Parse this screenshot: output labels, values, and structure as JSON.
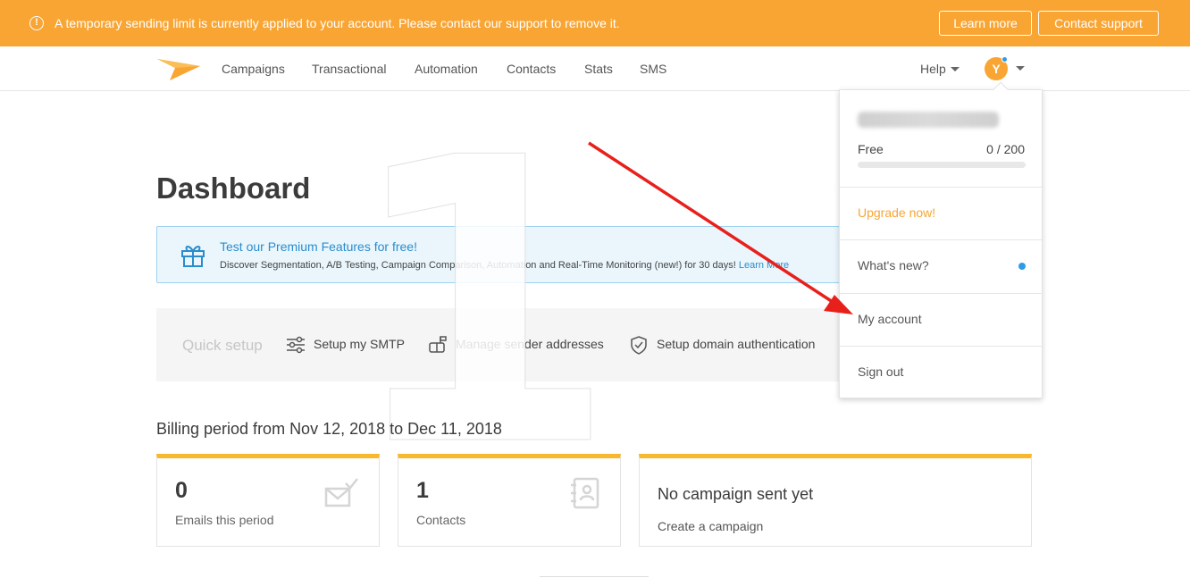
{
  "alert": {
    "icon": "exclamation-circle-icon",
    "message": "A temporary sending limit is currently applied to your account. Please contact our support to remove it.",
    "learn_more": "Learn more",
    "contact_support": "Contact support"
  },
  "nav": {
    "logo": "paper-plane-logo-icon",
    "items": [
      "Campaigns",
      "Transactional",
      "Automation",
      "Contacts",
      "Stats",
      "SMS"
    ],
    "help": "Help",
    "avatar_initial": "Y"
  },
  "page": {
    "title": "Dashboard"
  },
  "premium": {
    "icon": "gift-icon",
    "title": "Test our Premium Features for free!",
    "description": "Discover Segmentation, A/B Testing, Campaign Comparison, Automation and Real-Time Monitoring (new!) for 30 days!",
    "link": "Learn More"
  },
  "quick_setup": {
    "label": "Quick setup",
    "items": [
      {
        "icon": "sliders-icon",
        "label": "Setup my SMTP"
      },
      {
        "icon": "mailbox-icon",
        "label": "Manage sender addresses"
      },
      {
        "icon": "shield-check-icon",
        "label": "Setup domain authentication"
      }
    ]
  },
  "annotation": {
    "step_number": "1",
    "arrow_color": "#e8201c"
  },
  "billing": {
    "period": "Billing period from Nov 12, 2018 to Dec 11, 2018",
    "cards": [
      {
        "value": "0",
        "label": "Emails this period",
        "icon": "envelope-check-icon"
      },
      {
        "value": "1",
        "label": "Contacts",
        "icon": "address-book-icon"
      }
    ],
    "campaign_card": {
      "title": "No campaign sent yet",
      "link": "Create a campaign"
    }
  },
  "dropdown": {
    "plan": "Free",
    "quota": "0 / 200",
    "quota_fraction": 0,
    "upgrade": "Upgrade now!",
    "whats_new": "What's new?",
    "my_account": "My account",
    "sign_out": "Sign out"
  },
  "colors": {
    "brand_orange": "#f9a534",
    "accent_blue": "#2a8ccd",
    "card_top": "#f9b72d"
  }
}
